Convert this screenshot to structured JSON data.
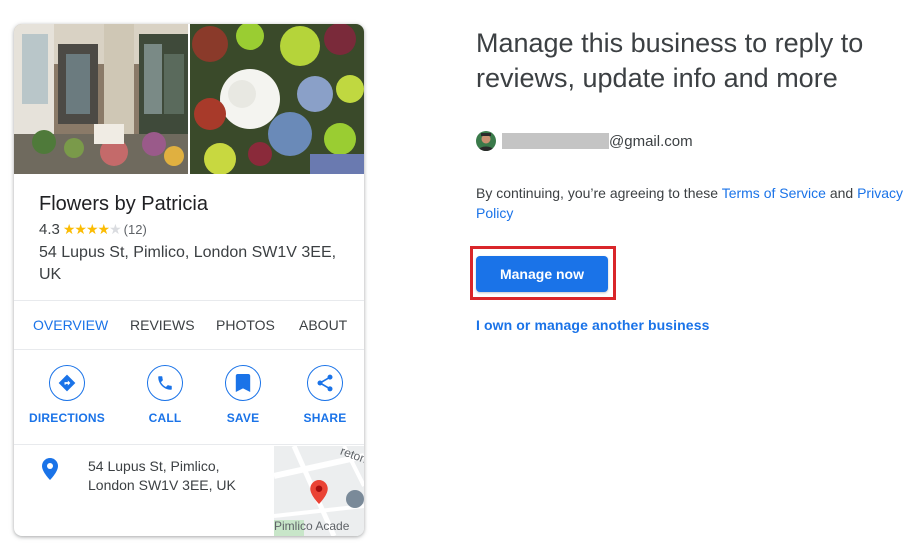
{
  "business": {
    "name": "Flowers by Patricia",
    "rating": "4.3",
    "stars": 4.3,
    "review_count": "(12)",
    "address_line1": "54 Lupus St, Pimlico, London SW1V 3EE,",
    "address_line2": "UK"
  },
  "tabs": [
    {
      "label": "OVERVIEW",
      "active": true
    },
    {
      "label": "REVIEWS",
      "active": false
    },
    {
      "label": "PHOTOS",
      "active": false
    },
    {
      "label": "ABOUT",
      "active": false
    }
  ],
  "actions": [
    {
      "label": "DIRECTIONS",
      "icon": "directions-icon"
    },
    {
      "label": "CALL",
      "icon": "phone-icon"
    },
    {
      "label": "SAVE",
      "icon": "bookmark-icon"
    },
    {
      "label": "SHARE",
      "icon": "share-icon"
    }
  ],
  "location": {
    "line1": "54 Lupus St, Pimlico,",
    "line2": "London SW1V 3EE, UK",
    "map_labels": {
      "street": "reton",
      "school": "Pimlico Acade"
    }
  },
  "panel": {
    "headline": "Manage this business to reply to reviews, update info and more",
    "email_domain": "@gmail.com",
    "consent_prefix": "By continuing, you’re agreeing to these ",
    "terms_link": "Terms of Service",
    "consent_and": " and ",
    "privacy_link": "Privacy Policy",
    "manage_button": "Manage now",
    "other_business_link": "I own or manage another business"
  },
  "colors": {
    "accent": "#1a73e8",
    "star": "#fbbc04",
    "highlight_box": "#d9262a",
    "map_pin": "#ea4335"
  }
}
